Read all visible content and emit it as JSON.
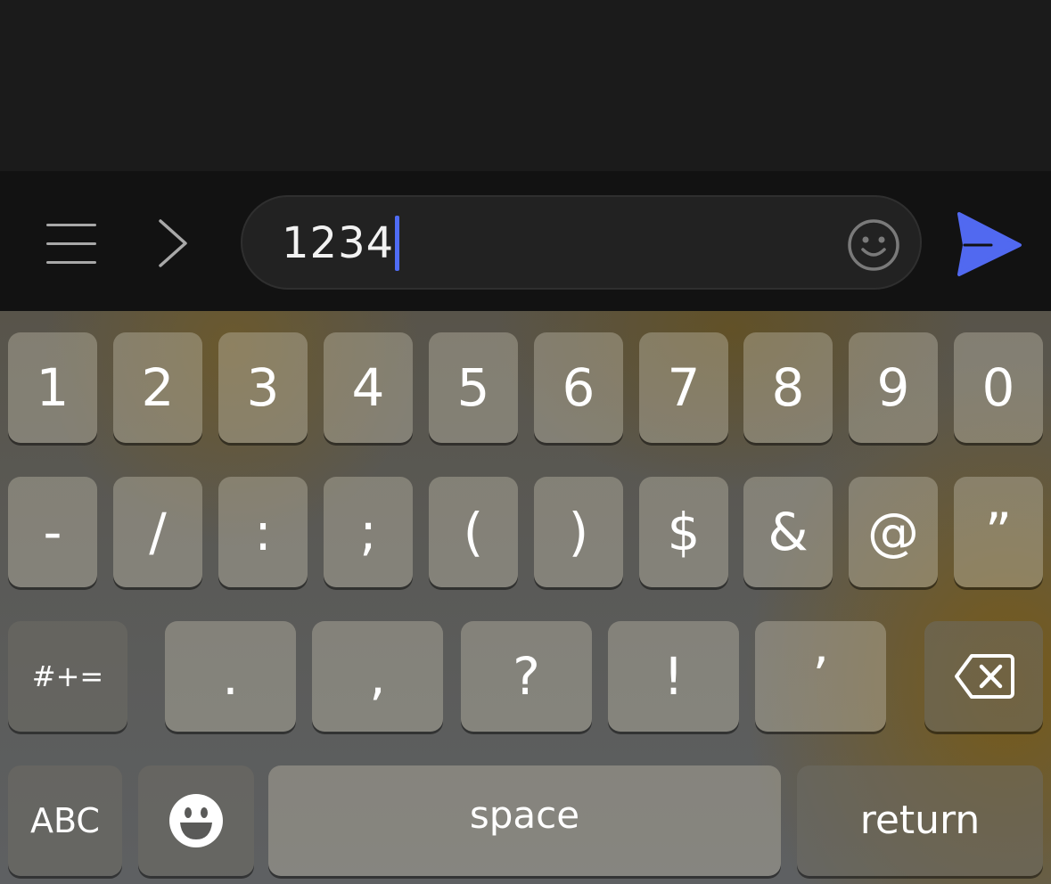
{
  "composer": {
    "input_value": "1234",
    "accent_color": "#4f6cf5",
    "icons": [
      "menu-icon",
      "chevron-right-icon",
      "emoji-face-icon",
      "send-icon"
    ]
  },
  "keyboard": {
    "row1": [
      "1",
      "2",
      "3",
      "4",
      "5",
      "6",
      "7",
      "8",
      "9",
      "0"
    ],
    "row2": [
      "-",
      "/",
      ":",
      ";",
      "(",
      ")",
      "$",
      "&",
      "@",
      "”"
    ],
    "row3": {
      "toggle": "#+=",
      "keys": [
        ".",
        ",",
        "?",
        "!",
        "’"
      ],
      "delete_icon": "backspace-icon"
    },
    "row4": {
      "abc": "ABC",
      "emoji_icon": "emoji-icon",
      "space": "space",
      "return": "return"
    }
  }
}
